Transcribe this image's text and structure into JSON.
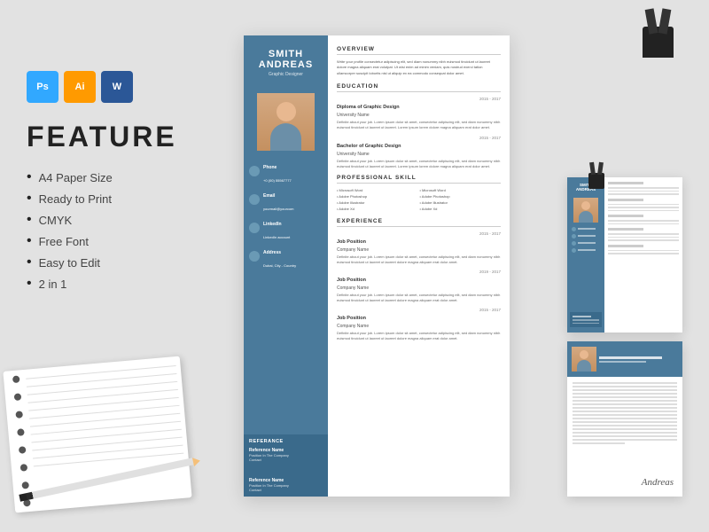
{
  "background": {
    "color": "#e2e2e2"
  },
  "software_icons": [
    {
      "label": "Ps",
      "name": "photoshop",
      "bg": "#31a8ff"
    },
    {
      "label": "Ai",
      "name": "illustrator",
      "bg": "#ff9a00"
    },
    {
      "label": "W",
      "name": "word",
      "bg": "#2b5797"
    }
  ],
  "feature_section": {
    "title": "FEATURE",
    "items": [
      "A4 Paper Size",
      "Ready to Print",
      "CMYK",
      "Free Font",
      "Easy to Edit",
      "2 in 1"
    ]
  },
  "resume": {
    "first_name": "SMITH",
    "last_name": "ANDREAS",
    "job_title": "Graphic Designer",
    "overview_title": "OVERVIEW",
    "overview_text": "Write your profile consectetur adipiscing elit, sed diam nonummy nibh euismod tincidunt ut laoreet dolore magna aliquam erat volutpat. Ut wisi enim ad minim veniam, quis nostrud exerci tation ullamcorper suscipit lobortis nisl ut aliquip ex ea commodo consequat dolor amet.",
    "education_title": "EDUCATION",
    "education": [
      {
        "degree": "Diploma of Graphic Design",
        "school": "University Name",
        "date": "2015 - 2017",
        "desc": "Definite about your job. Lorem ipsum dolor sit amet, consectetur adipiscing elit, sed diam nonummy nibh euismod tincidunt ut laoreet ut laoreet. Lorem ipsum lorem dolore magna aliquam erat dolor amet."
      },
      {
        "degree": "Bachelor of Graphic Design",
        "school": "University Name",
        "date": "2015 - 2017",
        "desc": "Definite about your job. Lorem ipsum dolor sit amet, consectetur adipiscing elit, sed diam nonummy nibh euismod tincidunt ut laoreet ut laoreet. Lorem ipsum lorem dolore magna aliquam erat dolor amet."
      }
    ],
    "skills_title": "PROFESSIONAL SKILL",
    "skills": [
      "Microsoft Word",
      "Microsoft Word",
      "Adobe Photoshop",
      "Adobe Photoshop",
      "Adobe Illustrator",
      "Adobe Illustrator",
      "Adobe Xd",
      "Adobe Xd"
    ],
    "experience_title": "EXPERIENCE",
    "experience": [
      {
        "title": "Job Position",
        "company": "Company Name",
        "date": "2015 - 2017",
        "desc": "Definite about your job. Lorem ipsum dolor sit amet, consectetur adipiscing elit, sed diam nonummy nibh euismod tincidunt ut laoreet ut laoreet dolore magna aliquam erat dolor amet."
      },
      {
        "title": "Job Position",
        "company": "Company Name",
        "date": "2019 - 2017",
        "desc": "Definite about your job. Lorem ipsum dolor sit amet, consectetur adipiscing elit, sed diam nonummy nibh euismod tincidunt ut laoreet ut laoreet dolore magna aliquam erat dolor amet."
      },
      {
        "title": "Job Position",
        "company": "Company Name",
        "date": "2015 - 2017",
        "desc": "Definite about your job. Lorem ipsum dolor sit amet, consectetur adipiscing elit, sed diam nonummy nibh euismod tincidunt ut laoreet ut laoreet dolore magna aliquam erat dolor amet."
      }
    ],
    "contact": [
      {
        "label": "Phone",
        "value": "+0 (00) 55567777"
      },
      {
        "label": "Email",
        "value": "yourmail@yourcom"
      },
      {
        "label": "LinkedIn",
        "value": "LinkedIn account"
      },
      {
        "label": "Address",
        "value": "Dubai, City - Country"
      }
    ],
    "reference_title": "REFERANCE",
    "references": [
      {
        "name": "Reference Name",
        "position": "Position In The Company",
        "contact": "Contact"
      },
      {
        "name": "Reference Name",
        "position": "Position In The Company",
        "contact": "Contact"
      }
    ]
  },
  "letter": {
    "signature": "Andreas"
  }
}
